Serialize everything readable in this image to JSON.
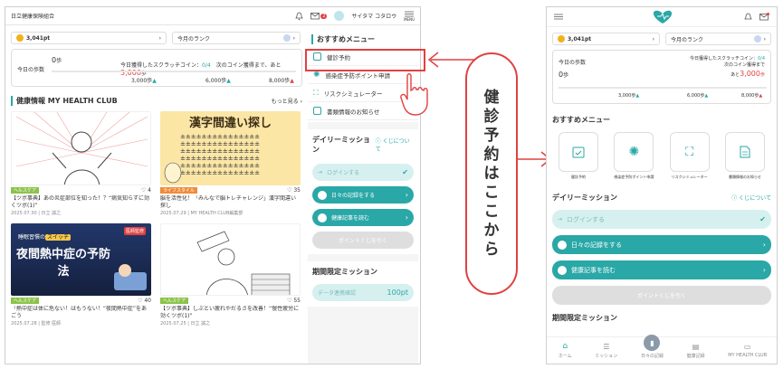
{
  "desktop": {
    "header": {
      "org": "日立健康保険組合",
      "user": "サイタマ コタロウ",
      "menu": "MENU",
      "badge": "2"
    },
    "points": {
      "value": "3,041pt",
      "rank_label": "今月のランク"
    },
    "steps": {
      "label": "今日の歩数",
      "value": "0",
      "unit": "歩",
      "coin_text": "今日獲得したスクラッチコイン：",
      "coin_count": "0/4",
      "next_text": "次のコイン獲得まで、あと",
      "next_value": "3,000",
      "next_unit": "歩",
      "marks": [
        "3,000歩",
        "6,000歩",
        "8,000歩"
      ]
    },
    "health_section": {
      "title": "健康情報 MY HEALTH CLUB",
      "more": "もっと見る"
    },
    "articles": [
      {
        "tag": "ヘルスケア",
        "likes": "4",
        "title": "【ツボ事典】あの炎症部位を知った！？“病気知らずに効くツボ(1)”",
        "date": "2025.07.30 | 日立 誠之"
      },
      {
        "tag": "ライフスタイル",
        "likes": "35",
        "title": "脳を活性化！「みんなで脳トレチャレンジ」漢字間違い探し",
        "date": "2025.07.29 | MY HEALTH CLUB編集部",
        "image_text": "漢字間違い探し"
      },
      {
        "tag": "ヘルスケア",
        "likes": "40",
        "title": "「熱中症は体に危ない！はもうない！“夜間熱中症”をあごう",
        "date": "2025.07.28 | 監修 医師",
        "image_text": "夜間熱中症の予防法",
        "image_top": "睡眠習慣の",
        "image_switch": "スイッチ",
        "image_badge": "医師監修"
      },
      {
        "tag": "ヘルスケア",
        "likes": "55",
        "title": "【ツボ事典】しぶとい疲れやだるさを改善！“慢性疲労に効くツボ(1)”",
        "date": "2025.07.25 | 日立 誠之"
      }
    ],
    "menu_title": "おすすめメニュー",
    "menu": [
      "健診予約",
      "感染症予防ポイント申請",
      "リスクシミュレーター",
      "書類情報のお知らせ"
    ],
    "daily": {
      "title": "デイリーミッション",
      "about": "くじについて",
      "items": [
        "ログインする",
        "日々の記録をする",
        "健康記事を読む"
      ],
      "button": "ポイントくじを引く"
    },
    "limited": {
      "title": "期間限定ミッション",
      "item": "データ連携確認",
      "pt": "100pt"
    }
  },
  "callout": {
    "chars": [
      "健",
      "診",
      "予",
      "約",
      "は",
      "こ",
      "こ",
      "か",
      "ら"
    ]
  },
  "mobile": {
    "points": {
      "value": "3,041pt",
      "rank_label": "今月のランク"
    },
    "steps": {
      "label": "今日の歩数",
      "value": "0",
      "unit": "歩",
      "coin_text": "今日獲得したスクラッチコイン：",
      "coin_count": "0/4",
      "next_text": "次のコイン獲得まで",
      "next_prefix": "あと",
      "next_value": "3,000",
      "next_unit": "歩",
      "marks": [
        "3,000歩",
        "6,000歩",
        "8,000歩"
      ]
    },
    "menu_title": "おすすめメニュー",
    "menu": [
      "健診予約",
      "感染症予防ポイント申請",
      "リスクシミュレーター",
      "書類情報のお知らせ"
    ],
    "daily": {
      "title": "デイリーミッション",
      "about": "くじについて",
      "items": [
        "ログインする",
        "日々の記録をする",
        "健康記事を読む"
      ],
      "button": "ポイントくじを引く"
    },
    "limited_title": "期間限定ミッション",
    "nav": [
      "ホーム",
      "ミッション",
      "日々の記録",
      "健康記録",
      "MY HEALTH CLUB"
    ]
  }
}
